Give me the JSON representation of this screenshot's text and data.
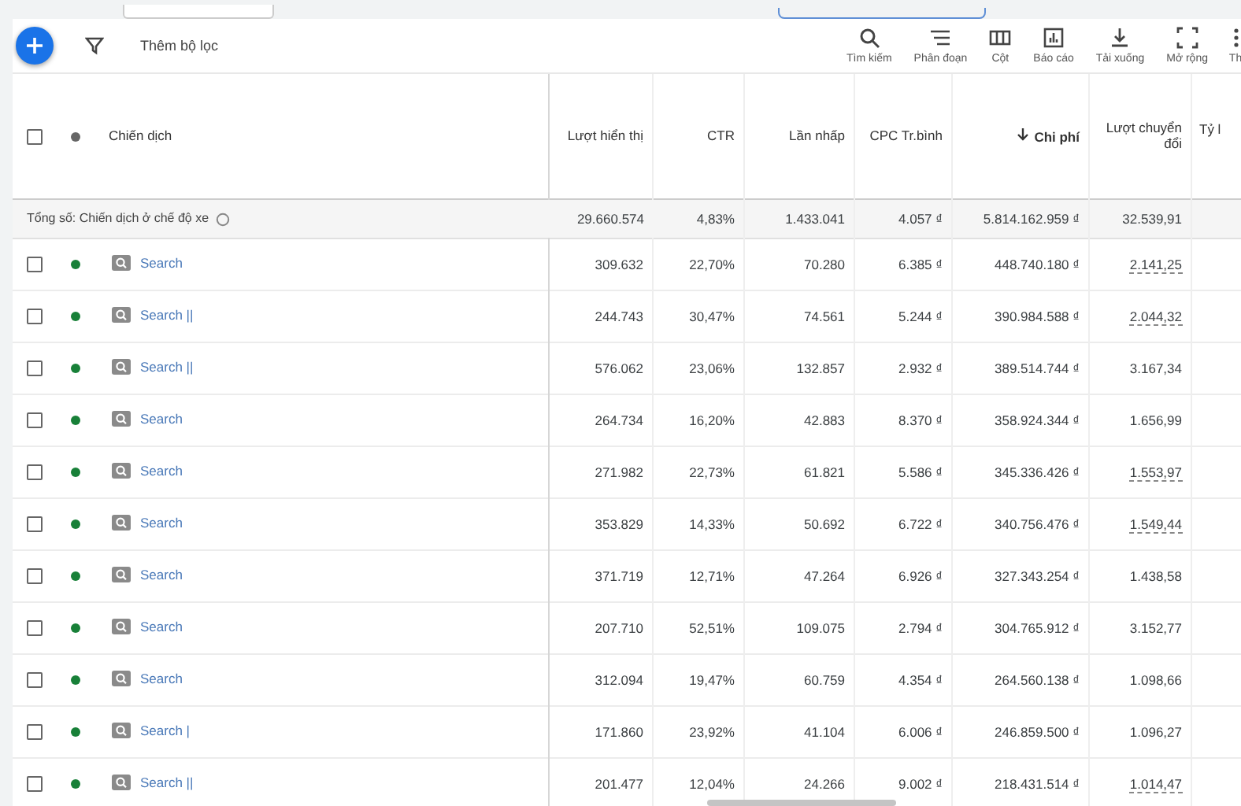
{
  "toolbar": {
    "filter_label": "Thêm bộ lọc",
    "actions": [
      {
        "kind": "search",
        "label": "Tìm kiếm"
      },
      {
        "kind": "segment",
        "label": "Phân đoạn"
      },
      {
        "kind": "columns",
        "label": "Cột"
      },
      {
        "kind": "report",
        "label": "Báo cáo"
      },
      {
        "kind": "download",
        "label": "Tải xuống"
      },
      {
        "kind": "expand",
        "label": "Mở rộng"
      },
      {
        "kind": "more",
        "label": "Th"
      }
    ]
  },
  "table": {
    "select_all_checked": false,
    "columns": [
      {
        "label": "Chiến dịch",
        "sorted": false
      },
      {
        "label": "Lượt hiển thị",
        "sorted": false
      },
      {
        "label": "CTR",
        "sorted": false
      },
      {
        "label": "Lần nhấp",
        "sorted": false
      },
      {
        "label": "CPC Tr.bình",
        "sorted": false
      },
      {
        "label": "Chi phí",
        "sorted": true
      },
      {
        "label": "Lượt chuyển đổi",
        "sorted": false
      },
      {
        "label": "Tỷ l",
        "sorted": false
      }
    ],
    "total": {
      "label": "Tổng số: Chiến dịch ở chế độ xe",
      "values": [
        "29.660.574",
        "4,83%",
        "1.433.041",
        "4.057 ₫",
        "5.814.162.959 ₫",
        "32.539,91"
      ]
    },
    "rows": [
      {
        "name": "Search",
        "checked": false,
        "color": "#188038",
        "values": [
          "309.632",
          "22,70%",
          "70.280",
          "6.385 ₫",
          "448.740.180 ₫",
          "2.141,25"
        ],
        "dotted": true
      },
      {
        "name": "Search ||",
        "checked": false,
        "color": "#188038",
        "values": [
          "244.743",
          "30,47%",
          "74.561",
          "5.244 ₫",
          "390.984.588 ₫",
          "2.044,32"
        ],
        "dotted": true
      },
      {
        "name": "Search ||",
        "checked": false,
        "color": "#188038",
        "values": [
          "576.062",
          "23,06%",
          "132.857",
          "2.932 ₫",
          "389.514.744 ₫",
          "3.167,34"
        ],
        "dotted": false
      },
      {
        "name": "Search",
        "checked": false,
        "color": "#188038",
        "values": [
          "264.734",
          "16,20%",
          "42.883",
          "8.370 ₫",
          "358.924.344 ₫",
          "1.656,99"
        ],
        "dotted": false
      },
      {
        "name": "Search",
        "checked": false,
        "color": "#188038",
        "values": [
          "271.982",
          "22,73%",
          "61.821",
          "5.586 ₫",
          "345.336.426 ₫",
          "1.553,97"
        ],
        "dotted": true
      },
      {
        "name": "Search",
        "checked": false,
        "color": "#188038",
        "values": [
          "353.829",
          "14,33%",
          "50.692",
          "6.722 ₫",
          "340.756.476 ₫",
          "1.549,44"
        ],
        "dotted": true
      },
      {
        "name": "Search",
        "checked": false,
        "color": "#188038",
        "values": [
          "371.719",
          "12,71%",
          "47.264",
          "6.926 ₫",
          "327.343.254 ₫",
          "1.438,58"
        ],
        "dotted": false
      },
      {
        "name": "Search",
        "checked": false,
        "color": "#188038",
        "values": [
          "207.710",
          "52,51%",
          "109.075",
          "2.794 ₫",
          "304.765.912 ₫",
          "3.152,77"
        ],
        "dotted": false
      },
      {
        "name": "Search",
        "checked": false,
        "color": "#188038",
        "values": [
          "312.094",
          "19,47%",
          "60.759",
          "4.354 ₫",
          "264.560.138 ₫",
          "1.098,66"
        ],
        "dotted": false
      },
      {
        "name": "Search |",
        "checked": false,
        "color": "#188038",
        "values": [
          "171.860",
          "23,92%",
          "41.104",
          "6.006 ₫",
          "246.859.500 ₫",
          "1.096,27"
        ],
        "dotted": false
      },
      {
        "name": "Search ||",
        "checked": false,
        "color": "#188038",
        "values": [
          "201.477",
          "12,04%",
          "24.266",
          "9.002 ₫",
          "218.431.514 ₫",
          "1.014,47"
        ],
        "dotted": true
      }
    ]
  }
}
